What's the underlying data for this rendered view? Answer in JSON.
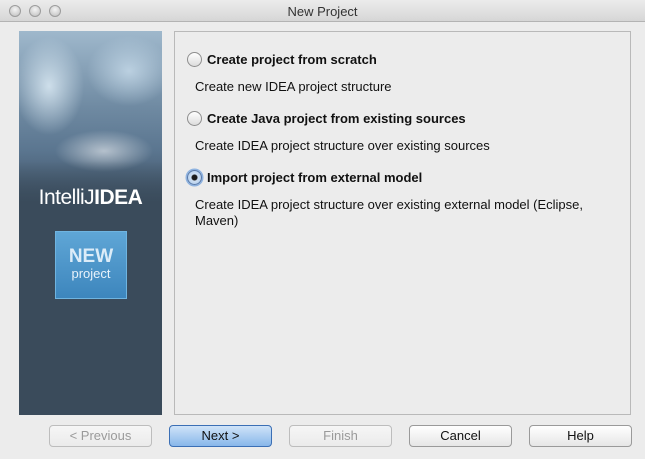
{
  "window": {
    "title": "New Project"
  },
  "banner": {
    "logo_light": "IntelliJ",
    "logo_bold": "IDEA",
    "badge_top": "NEW",
    "badge_bottom": "project"
  },
  "options": [
    {
      "label": "Create project from scratch",
      "description": "Create new IDEA project structure",
      "selected": false
    },
    {
      "label": "Create Java project from existing sources",
      "description": "Create IDEA project structure over existing sources",
      "selected": false
    },
    {
      "label": "Import project from external model",
      "description": "Create IDEA project structure over existing external model (Eclipse, Maven)",
      "selected": true
    }
  ],
  "buttons": {
    "previous": "< Previous",
    "next": "Next >",
    "finish": "Finish",
    "cancel": "Cancel",
    "help": "Help"
  }
}
